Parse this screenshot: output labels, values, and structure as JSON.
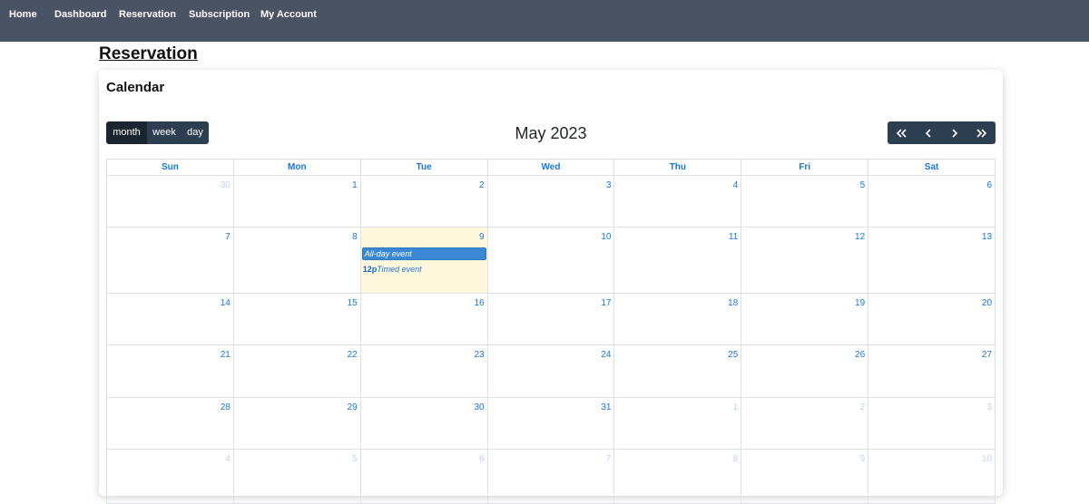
{
  "nav": {
    "home": "Home",
    "dashboard": "Dashboard",
    "reservation": "Reservation",
    "subscription": "Subscription",
    "account": "My Account"
  },
  "page": {
    "title": "Reservation"
  },
  "calendar": {
    "card_title": "Calendar",
    "views": [
      "month",
      "week",
      "day"
    ],
    "active_view": "month",
    "month_title": "May 2023",
    "nav_icons": [
      "double-chevron-left-icon",
      "chevron-left-icon",
      "chevron-right-icon",
      "double-chevron-right-icon"
    ],
    "weekdays": [
      "Sun",
      "Mon",
      "Tue",
      "Wed",
      "Thu",
      "Fri",
      "Sat"
    ],
    "weeks": [
      [
        {
          "n": "30",
          "o": true
        },
        {
          "n": "1"
        },
        {
          "n": "2"
        },
        {
          "n": "3"
        },
        {
          "n": "4"
        },
        {
          "n": "5"
        },
        {
          "n": "6"
        }
      ],
      [
        {
          "n": "7"
        },
        {
          "n": "8"
        },
        {
          "n": "9",
          "today": true
        },
        {
          "n": "10"
        },
        {
          "n": "11"
        },
        {
          "n": "12"
        },
        {
          "n": "13"
        }
      ],
      [
        {
          "n": "14"
        },
        {
          "n": "15"
        },
        {
          "n": "16"
        },
        {
          "n": "17"
        },
        {
          "n": "18"
        },
        {
          "n": "19"
        },
        {
          "n": "20"
        }
      ],
      [
        {
          "n": "21"
        },
        {
          "n": "22"
        },
        {
          "n": "23"
        },
        {
          "n": "24"
        },
        {
          "n": "25"
        },
        {
          "n": "26"
        },
        {
          "n": "27"
        }
      ],
      [
        {
          "n": "28"
        },
        {
          "n": "29"
        },
        {
          "n": "30"
        },
        {
          "n": "31"
        },
        {
          "n": "1",
          "o": true
        },
        {
          "n": "2",
          "o": true
        },
        {
          "n": "3",
          "o": true
        }
      ],
      [
        {
          "n": "4",
          "o": true
        },
        {
          "n": "5",
          "o": true
        },
        {
          "n": "6",
          "o": true
        },
        {
          "n": "7",
          "o": true
        },
        {
          "n": "8",
          "o": true
        },
        {
          "n": "9",
          "o": true
        },
        {
          "n": "10",
          "o": true
        }
      ]
    ],
    "events": {
      "allday_label": "All-day event",
      "timed_time": "12p",
      "timed_label": "Timed event"
    },
    "colors": {
      "header": "#4a5363",
      "accent": "#1976d2",
      "button": "#2c3e50",
      "today": "#fff8dc",
      "event": "#3a87d6"
    }
  }
}
